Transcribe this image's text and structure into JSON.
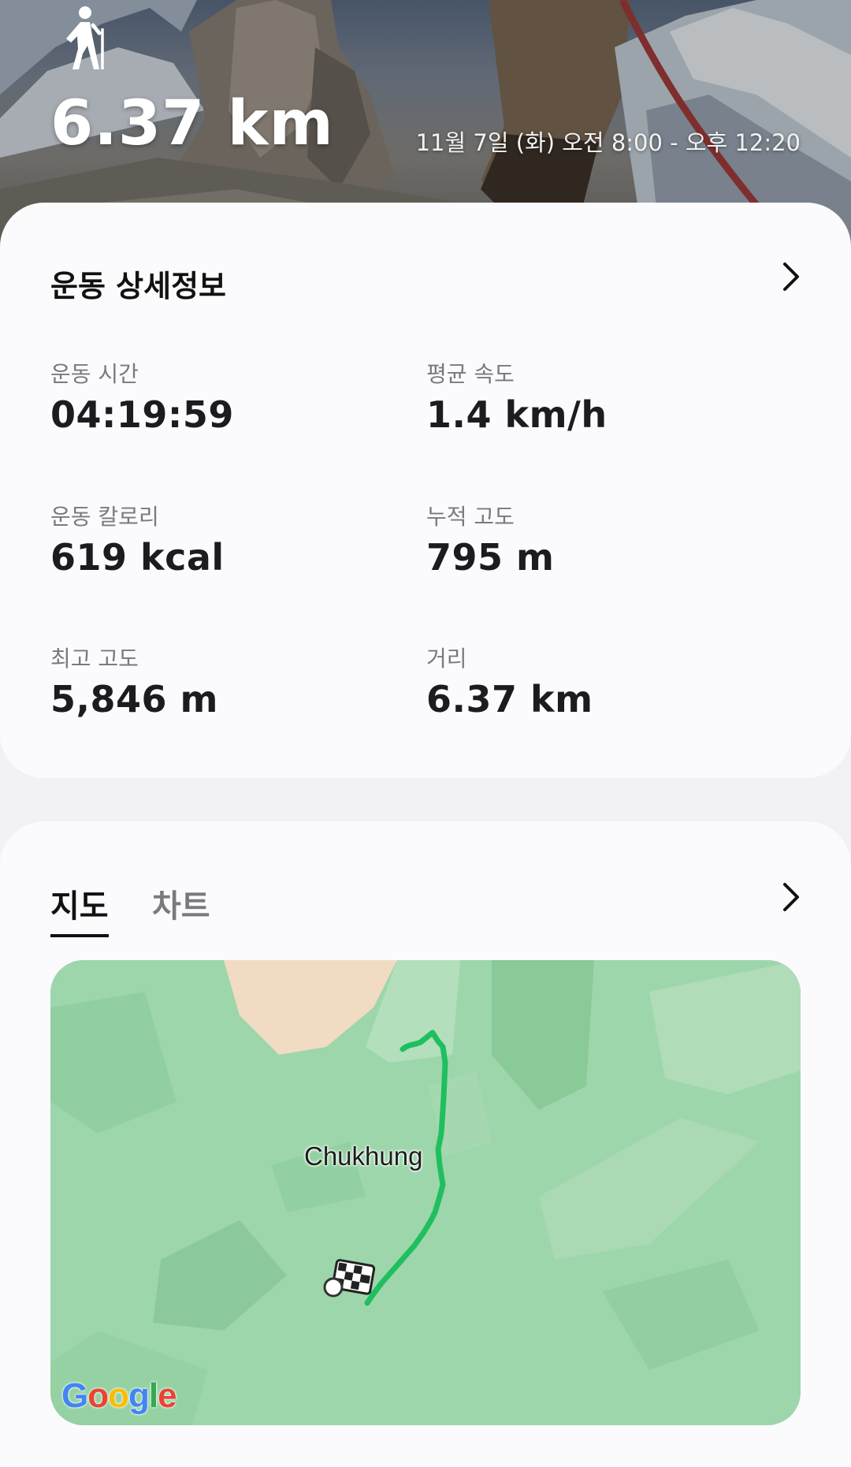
{
  "hero": {
    "activity_icon": "hiking-person-icon",
    "distance": "6.37 km",
    "datetime": "11월 7일 (화) 오전 8:00 - 오후 12:20"
  },
  "details": {
    "title": "운동 상세정보",
    "chevron_icon": "chevron-right-icon",
    "stats": [
      {
        "label": "운동 시간",
        "value": "04:19:59"
      },
      {
        "label": "평균 속도",
        "value": "1.4 km/h"
      },
      {
        "label": "운동 칼로리",
        "value": "619 kcal"
      },
      {
        "label": "누적 고도",
        "value": "795 m"
      },
      {
        "label": "최고 고도",
        "value": "5,846 m"
      },
      {
        "label": "거리",
        "value": "6.37 km"
      }
    ]
  },
  "map_section": {
    "tabs": [
      {
        "label": "지도",
        "active": true
      },
      {
        "label": "차트",
        "active": false
      }
    ],
    "chevron_icon": "chevron-right-icon",
    "place_label": "Chukhung",
    "google_logo": [
      "G",
      "o",
      "o",
      "g",
      "l",
      "e"
    ],
    "route_color": "#1fbf5f",
    "map_color": "#9ed6ab"
  }
}
